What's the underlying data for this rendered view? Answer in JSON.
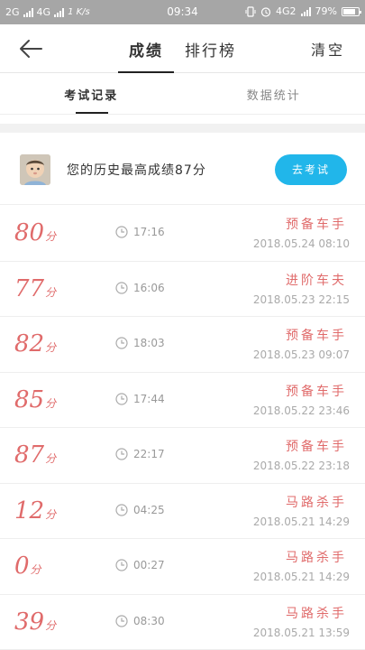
{
  "status_bar": {
    "network1": "2G",
    "network2": "4G",
    "speed": "1 K/s",
    "time": "09:34",
    "network3": "4G2",
    "battery": "79%",
    "battery_level": 0.79
  },
  "header": {
    "tab_scores": "成绩",
    "tab_ranking": "排行榜",
    "clear": "清空"
  },
  "subtabs": {
    "records": "考试记录",
    "stats": "数据统计"
  },
  "best": {
    "text": "您的历史最高成绩87分",
    "button": "去考试"
  },
  "records": [
    {
      "score": "80",
      "unit": "分",
      "duration": "17:16",
      "rank": "预备车手",
      "datetime": "2018.05.24  08:10"
    },
    {
      "score": "77",
      "unit": "分",
      "duration": "16:06",
      "rank": "进阶车夫",
      "datetime": "2018.05.23  22:15"
    },
    {
      "score": "82",
      "unit": "分",
      "duration": "18:03",
      "rank": "预备车手",
      "datetime": "2018.05.23  09:07"
    },
    {
      "score": "85",
      "unit": "分",
      "duration": "17:44",
      "rank": "预备车手",
      "datetime": "2018.05.22  23:46"
    },
    {
      "score": "87",
      "unit": "分",
      "duration": "22:17",
      "rank": "预备车手",
      "datetime": "2018.05.22  23:18"
    },
    {
      "score": "12",
      "unit": "分",
      "duration": "04:25",
      "rank": "马路杀手",
      "datetime": "2018.05.21  14:29"
    },
    {
      "score": "0",
      "unit": "分",
      "duration": "00:27",
      "rank": "马路杀手",
      "datetime": "2018.05.21  14:29"
    },
    {
      "score": "39",
      "unit": "分",
      "duration": "08:30",
      "rank": "马路杀手",
      "datetime": "2018.05.21  13:59"
    }
  ]
}
